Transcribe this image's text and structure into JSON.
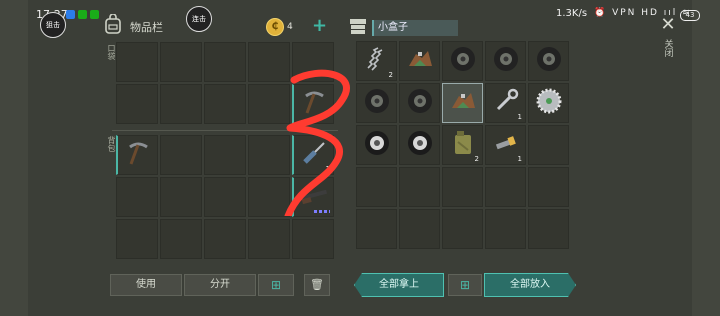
{
  "status_bar": {
    "time": "17:27",
    "net_speed": "1.3K/s",
    "icons_text": "⏰ VPN HD ııl ≋",
    "battery": "43"
  },
  "overlay_buttons": {
    "top_left": "狙击",
    "top_center": "连击"
  },
  "inventory": {
    "title": "物品栏",
    "pocket_label": "口袋",
    "backpack_label": "背包"
  },
  "currency": {
    "coin_symbol": "₵",
    "count": "4",
    "plus": "+"
  },
  "container": {
    "title": "小盒子",
    "close_label": "关闭",
    "close_glyph": "✕"
  },
  "pocket_slots": [
    {
      "item": null
    },
    {
      "item": null
    },
    {
      "item": null
    },
    {
      "item": null
    },
    {
      "item": null
    },
    {
      "item": null
    },
    {
      "item": null
    },
    {
      "item": null
    },
    {
      "item": null
    },
    {
      "item": "pickaxe",
      "qty": ""
    }
  ],
  "backpack_slots": [
    {
      "item": "pickaxe",
      "qty": ""
    },
    {
      "item": null
    },
    {
      "item": null
    },
    {
      "item": null
    },
    {
      "item": "screwdriver",
      "qty": "1"
    },
    {
      "item": null
    },
    {
      "item": null
    },
    {
      "item": null
    },
    {
      "item": null
    },
    {
      "item": "shotgun",
      "qty": ""
    },
    {
      "item": null
    },
    {
      "item": null
    },
    {
      "item": null
    },
    {
      "item": null
    },
    {
      "item": null
    }
  ],
  "container_slots": [
    {
      "item": "spring",
      "qty": "2"
    },
    {
      "item": "scrap",
      "qty": ""
    },
    {
      "item": "tire",
      "qty": ""
    },
    {
      "item": "tire",
      "qty": ""
    },
    {
      "item": "tire",
      "qty": ""
    },
    {
      "item": "tire",
      "qty": ""
    },
    {
      "item": "tire",
      "qty": ""
    },
    {
      "item": "scrap",
      "qty": ""
    },
    {
      "item": "wrench",
      "qty": "1"
    },
    {
      "item": "sawblade",
      "qty": ""
    },
    {
      "item": "tire-white",
      "qty": ""
    },
    {
      "item": "tire-white",
      "qty": ""
    },
    {
      "item": "jerrycan",
      "qty": "2"
    },
    {
      "item": "flashlight",
      "qty": "1"
    },
    {
      "item": null
    },
    {
      "item": null
    },
    {
      "item": null
    },
    {
      "item": null
    },
    {
      "item": null
    },
    {
      "item": null
    },
    {
      "item": null
    },
    {
      "item": null
    },
    {
      "item": null
    },
    {
      "item": null
    },
    {
      "item": null
    }
  ],
  "buttons": {
    "use": "使用",
    "split": "分开",
    "sort_glyph": "⊞",
    "trash_glyph": "🗑",
    "take_all": "全部拿上",
    "put_all": "全部放入"
  },
  "colors": {
    "accent": "#4bb7a6",
    "scribble": "#ff3b30"
  }
}
